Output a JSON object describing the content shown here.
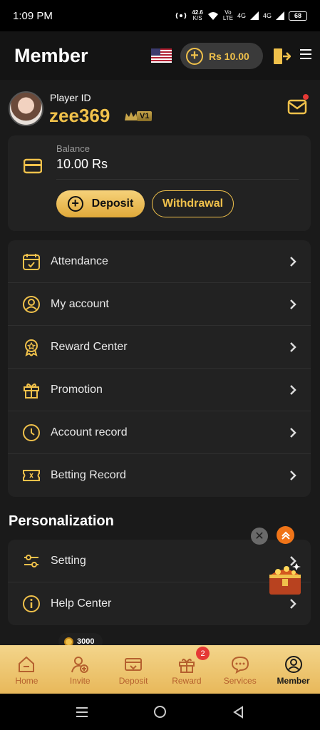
{
  "status": {
    "time": "1:09 PM",
    "net_speed": "42.6",
    "net_unit": "K/S",
    "volte_top": "Vo",
    "volte_bottom": "LTE",
    "sig1": "4G",
    "sig2": "4G",
    "battery": "68"
  },
  "header": {
    "title": "Member",
    "wallet_amount": "Rs 10.00"
  },
  "profile": {
    "label": "Player ID",
    "name": "zee369",
    "vip": "V1"
  },
  "balance": {
    "label": "Balance",
    "value": "10.00 Rs",
    "deposit_label": "Deposit",
    "withdrawal_label": "Withdrawal"
  },
  "menu": [
    {
      "label": "Attendance",
      "icon": "calendar-check-icon"
    },
    {
      "label": "My account",
      "icon": "user-circle-icon"
    },
    {
      "label": "Reward Center",
      "icon": "medal-icon"
    },
    {
      "label": "Promotion",
      "icon": "gift-icon"
    },
    {
      "label": "Account record",
      "icon": "clock-icon"
    },
    {
      "label": "Betting Record",
      "icon": "ticket-icon"
    }
  ],
  "personalization": {
    "title": "Personalization",
    "items": [
      {
        "label": "Setting",
        "icon": "sliders-icon"
      },
      {
        "label": "Help Center",
        "icon": "info-icon"
      }
    ]
  },
  "coin_bubble": "3000",
  "tabs": [
    {
      "label": "Home",
      "icon": "home-icon"
    },
    {
      "label": "Invite",
      "icon": "invite-icon"
    },
    {
      "label": "Deposit",
      "icon": "deposit-icon"
    },
    {
      "label": "Reward",
      "icon": "reward-icon"
    },
    {
      "label": "Services",
      "icon": "chat-icon"
    },
    {
      "label": "Member",
      "icon": "member-icon"
    }
  ],
  "reward_badge": "2",
  "colors": {
    "accent": "#f0c14b",
    "bg": "#1a1a1a",
    "card": "#222222",
    "tabbar": "#f3d58b"
  }
}
